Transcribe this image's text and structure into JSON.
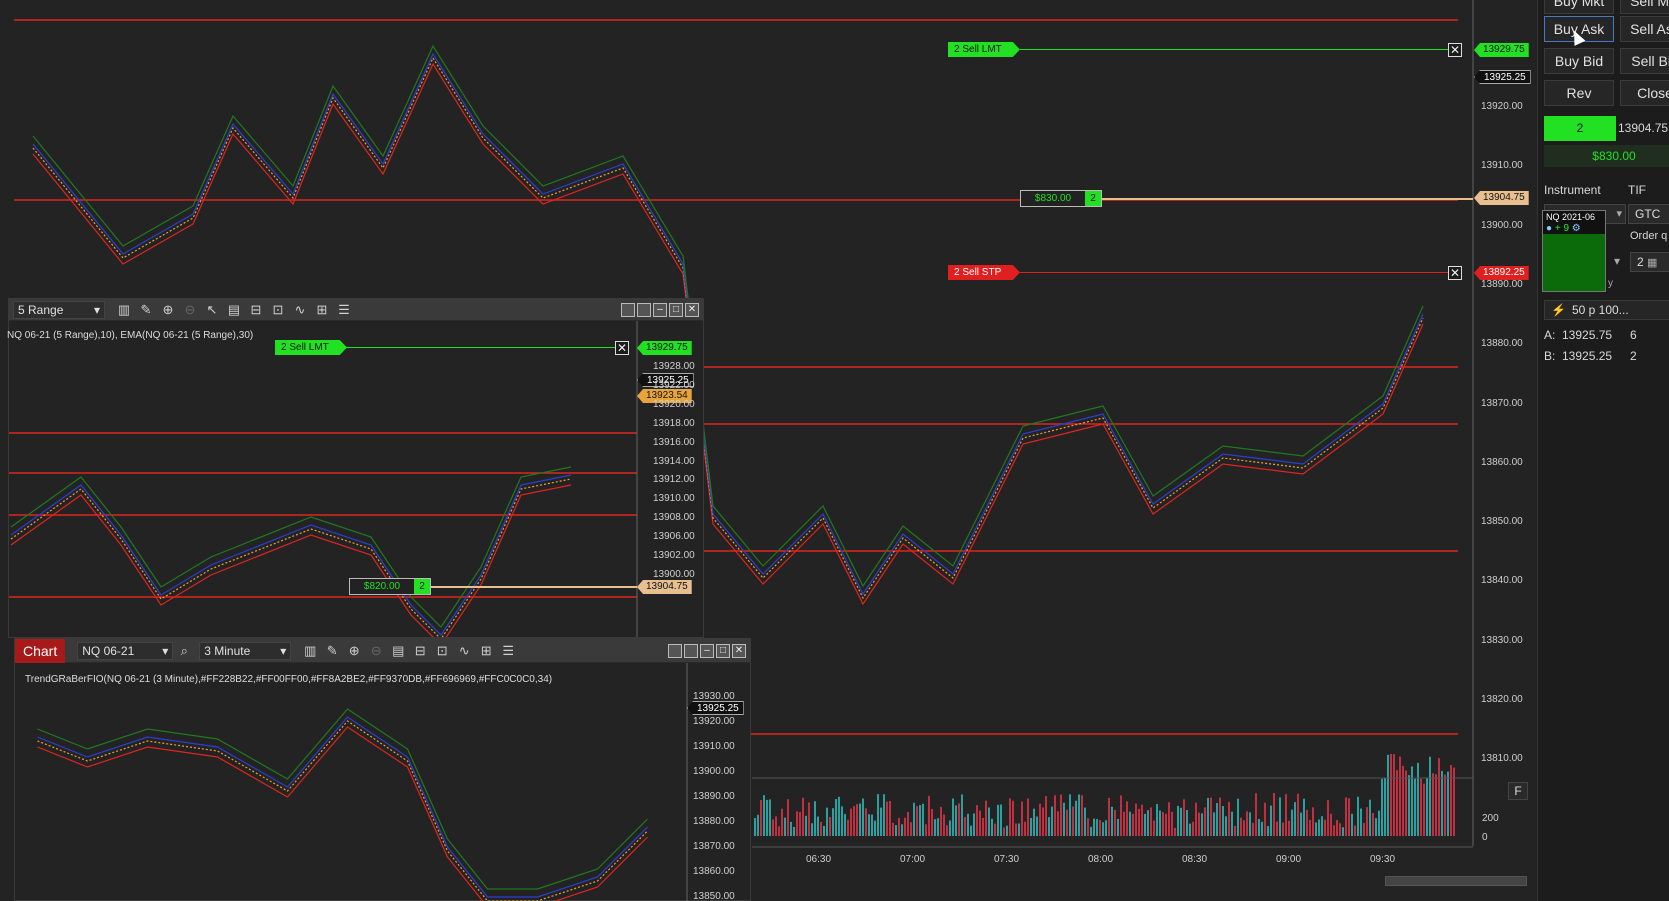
{
  "main_chart": {
    "order_lines": {
      "sell_lmt": {
        "label": "2  Sell LMT",
        "price": "13929.75"
      },
      "position": {
        "pnl": "$830.00",
        "qty": "2",
        "price": "13904.75"
      },
      "sell_stp": {
        "label": "2  Sell STP",
        "price": "13892.25"
      }
    },
    "last_price": "13925.25",
    "y_axis": [
      "13920.00",
      "13910.00",
      "13900.00",
      "13890.00",
      "13880.00",
      "13870.00",
      "13860.00",
      "13850.00",
      "13840.00",
      "13830.00",
      "13820.00",
      "13810.00"
    ],
    "x_axis": [
      "06:30",
      "07:00",
      "07:30",
      "08:00",
      "08:30",
      "09:00",
      "09:30"
    ],
    "volume_axis": [
      "200",
      "0"
    ],
    "volume_button": "F"
  },
  "range_chart": {
    "interval": "5 Range",
    "indicator_label": "NQ 06-21 (5 Range),10), EMA(NQ 06-21 (5 Range),30)",
    "order_lines": {
      "sell_lmt": {
        "label": "2  Sell LMT",
        "price": "13929.75"
      },
      "position": {
        "pnl": "$820.00",
        "qty": "2",
        "price": "13904.75"
      }
    },
    "last_price": "13925.25",
    "ema_price": "13923.54",
    "y_axis": [
      "13928.00",
      "13922.00",
      "13920.00",
      "13918.00",
      "13916.00",
      "13914.00",
      "13912.00",
      "13910.00",
      "13908.00",
      "13906.00",
      "13902.00",
      "13900.00"
    ]
  },
  "minute_chart": {
    "tab_label": "Chart",
    "instrument": "NQ 06-21",
    "interval": "3 Minute",
    "indicator_label": "TrendGRaBerFIO(NQ 06-21 (3 Minute),#FF228B22,#FF00FF00,#FF8A2BE2,#FF9370DB,#FF696969,#FFC0C0C0,34)",
    "last_price": "13925.25",
    "y_axis": [
      "13930.00",
      "13920.00",
      "13910.00",
      "13900.00",
      "13890.00",
      "13880.00",
      "13870.00",
      "13860.00",
      "13850.00"
    ]
  },
  "order_panel": {
    "buttons": {
      "buy_mkt": "Buy Mkt",
      "sell_mkt": "Sell Mkt",
      "buy_ask": "Buy Ask",
      "sell_ask": "Sell Ask",
      "buy_bid": "Buy Bid",
      "sell_bid": "Sell Bid",
      "rev": "Rev",
      "close": "Close"
    },
    "position_qty": "2",
    "position_price": "13904.75",
    "unrealized": "$830.00",
    "instrument_label": "Instrument",
    "tif_label": "TIF",
    "instrument_value": "NQ 2021-06",
    "tif_value": "GTC",
    "order_qty_label": "Order q",
    "quantity": "2",
    "strategy_fragment": "y",
    "atm": "50 p 100...",
    "ask_label": "A:",
    "ask_price": "13925.75",
    "ask_size": "6",
    "bid_label": "B:",
    "bid_price": "13925.25",
    "bid_size": "2"
  },
  "colors": {
    "bull": "#33e233",
    "bear": "#a67de8",
    "level": "#e0241f",
    "sell_lmt": "#22e022",
    "position": "#e8c090",
    "stop": "#e02020"
  }
}
